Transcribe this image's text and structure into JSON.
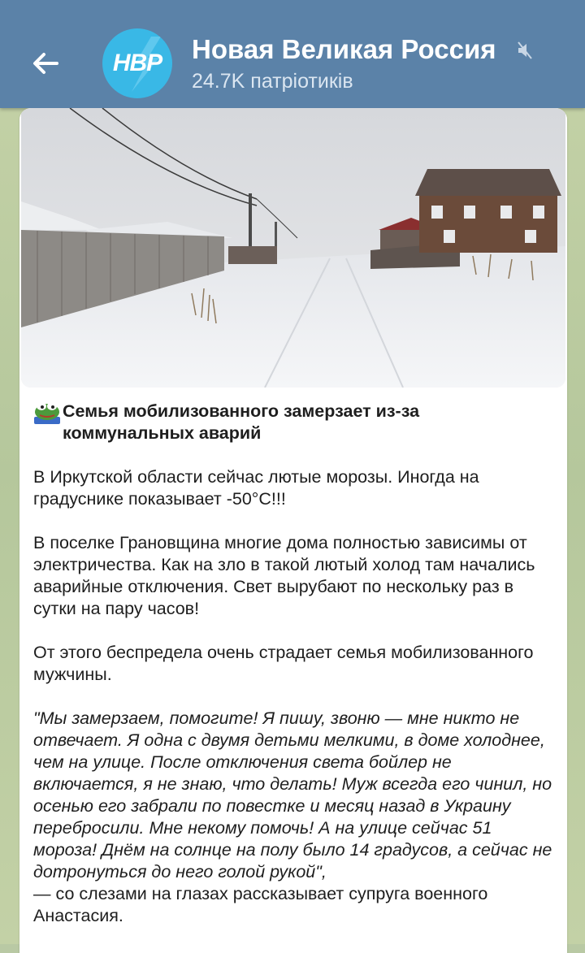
{
  "header": {
    "back_icon": "arrow-left-icon",
    "avatar_text": "НВР",
    "title": "Новая Великая Россия",
    "mute_icon": "speaker-muted-icon",
    "subtitle": "24.7K патріотиків"
  },
  "post": {
    "photo_icon": "winter-village-photo",
    "headline_emoji": "pepe-frog-icon",
    "headline": "Семья мобилизованного замерзает из-за коммунальных аварий",
    "paragraphs": [
      "В Иркутской области сейчас лютые морозы. Иногда на градуснике показывает -50°С!!!",
      "В поселке Грановщина многие дома полностью зависимы от электричества. Как на зло в такой лютый холод там начались аварийные отключения. Свет вырубают по нескольку раз в сутки на пару часов!",
      "От этого беспредела очень страдает семья мобилизованного мужчины."
    ],
    "quote": "\"Мы замерзаем, помогите! Я пишу, звоню — мне никто не отвечает. Я одна с двумя детьми мелкими, в доме холоднее, чем на улице. После отключения света бойлер не включается, я не знаю, что делать! Муж всегда его чинил, но осенью его забрали по повестке и месяц назад в Украину перебросили. Мне некому помочь! А на улице сейчас 51 мороза! Днём на солнце на полу было 14 градусов, а сейчас не дотронуться до него голой рукой\",",
    "attribution": "— со слезами на глазах рассказывает супруга военного Анастасия."
  },
  "colors": {
    "header_bg": "#5b82a8",
    "avatar_bg": "#39b8e6",
    "bubble_bg": "#ffffff",
    "chat_bg": "#c6d3a8"
  }
}
